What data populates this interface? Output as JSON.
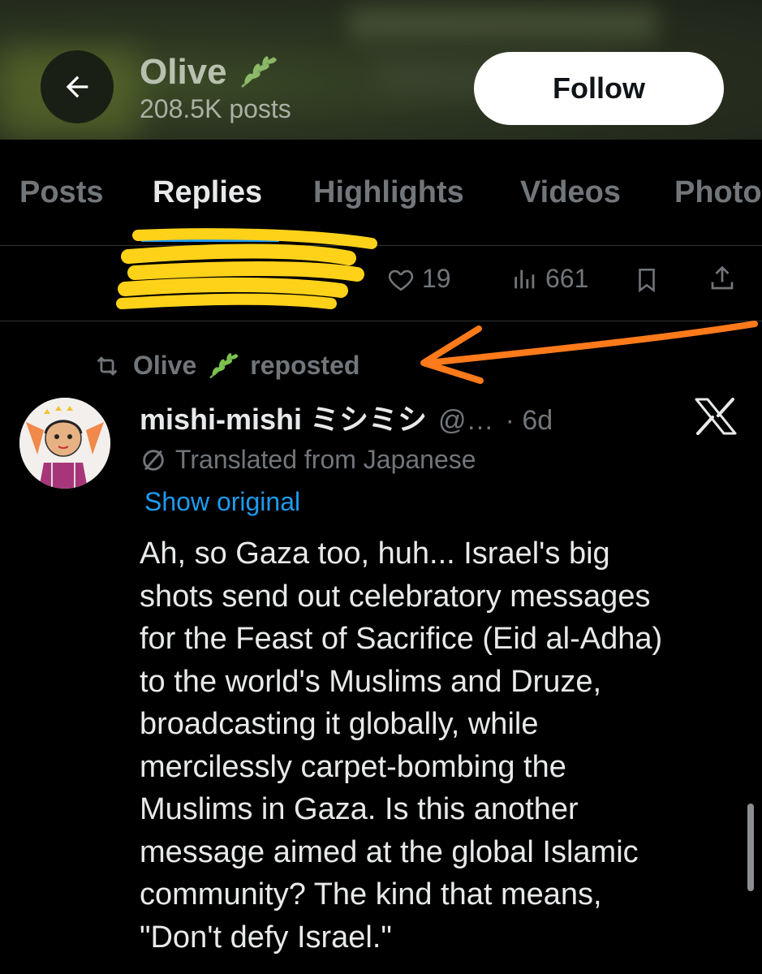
{
  "header": {
    "back_icon": "arrow-left-icon",
    "name": "Olive",
    "name_emoji": "herb-icon",
    "posts_count": "208.5K posts",
    "follow_label": "Follow"
  },
  "tabs": [
    {
      "label": "Posts",
      "active": false
    },
    {
      "label": "Replies",
      "active": true
    },
    {
      "label": "Highlights",
      "active": false
    },
    {
      "label": "Videos",
      "active": false
    },
    {
      "label": "Photo",
      "active": false
    }
  ],
  "previous_post": {
    "likes": "19",
    "views": "661"
  },
  "repost": {
    "name": "Olive",
    "suffix": "reposted"
  },
  "post": {
    "author": "mishi-mishi ミシミシ",
    "handle": "@…",
    "time": "· 6d",
    "translated_label": "Translated from Japanese",
    "show_original": "Show original",
    "body": "Ah, so Gaza too, huh... Israel's big\nshots send out celebratory messages\nfor the Feast of Sacrifice (Eid al-Adha)\nto the world's Muslims and Druze,\nbroadcasting it globally, while\nmercilessly carpet-bombing the\nMuslims in Gaza. Is this another\nmessage aimed at the global Islamic\ncommunity? The kind that means,\n\"Don't defy Israel.\""
  },
  "colors": {
    "background": "#000000",
    "text": "#e7e9ea",
    "muted": "#71767b",
    "link": "#1d9bf0",
    "highlighter": "#ffd21a",
    "annotation_arrow": "#ff7a1a"
  }
}
